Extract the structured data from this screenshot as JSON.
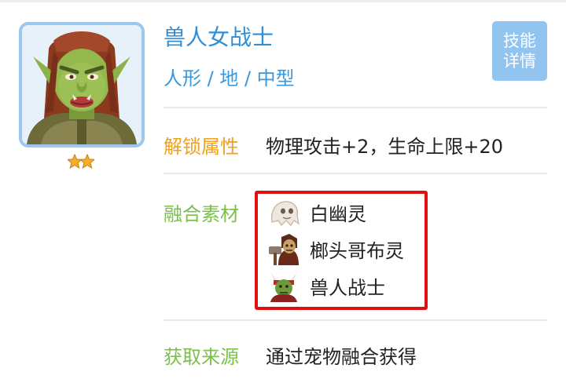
{
  "pet": {
    "name": "兽人女战士",
    "tags": "人形 / 地 / 中型",
    "star_count": 2
  },
  "skill_button": {
    "line1": "技能",
    "line2": "详情"
  },
  "unlock": {
    "label": "解锁属性",
    "value": "物理攻击+2，生命上限+20"
  },
  "materials": {
    "label": "融合素材",
    "items": [
      {
        "name": "白幽灵",
        "icon": "white-ghost-icon"
      },
      {
        "name": "榔头哥布灵",
        "icon": "hammer-goblin-icon"
      },
      {
        "name": "兽人战士",
        "icon": "orc-warrior-icon"
      }
    ]
  },
  "source": {
    "label": "获取来源",
    "value": "通过宠物融合获得"
  },
  "colors": {
    "name_blue": "#2f8ed8",
    "unlock_label": "#f0a020",
    "materials_label": "#7cbf4a",
    "source_label": "#7cbf4a",
    "highlight_red": "#e01010",
    "button_bg": "#92c4f0"
  }
}
